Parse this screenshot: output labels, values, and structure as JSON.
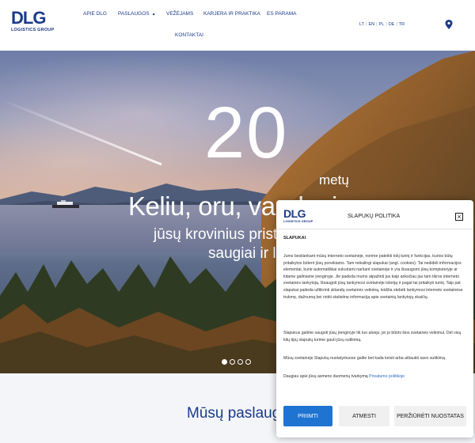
{
  "logo": {
    "mark": "DLG",
    "sub": "LOGISTICS GROUP"
  },
  "nav": {
    "items": [
      "APIE DLG",
      "PASLAUGOS",
      "VEŽĖJAMS",
      "KARJERA IR PRAKTIKA",
      "ES PARAMA",
      "KONTAKTAI"
    ],
    "dropdown_arrow": "▲"
  },
  "languages": [
    "LT",
    "EN",
    "PL",
    "DE",
    "TR"
  ],
  "hero": {
    "number": "20",
    "number_suffix": "metų",
    "headline": "Keliu, oru, vandeniu",
    "subline_1": "jūsų krovinius pristatome",
    "subline_2": "saugiai ir laiku"
  },
  "carousel": {
    "slides": 4,
    "active_index": 0
  },
  "services": {
    "title": "Mūsų paslaugos"
  },
  "cookie_modal": {
    "logo_mark": "DLG",
    "logo_sub": "LOGISTICS GROUP",
    "title": "SLAPUKŲ POLITIKA",
    "close_symbol": "×",
    "section": "SLAPUKAI",
    "paragraph_1": "Jums besilankant mūsų interneto svetainėje, norime pateikti tokį turinį ir funkcijas, kurios būtų pritaikytos būtent jūsų poreikiams. Tam reikalingi slapukai (angl. cookies). Tai nedideli informacijos elementai, kurie automatiškai sukuriami naršant svetainėje ir yra išsaugomi jūsų kompiuteryje ar kitame galiniame įrenginyje. Jie padeda mums atpažinti jus kaip anksčiau jau tam tikros interneto svetainės lankytoją. Išsaugoti jūsų lankymosi svetainėje istoriją ir pagal tai pritaikyti turinį. Taip pat slapukai padeda užtikrinti sklandų svetainės veikimą, leidžia stebėti lankymosi interneto svetainėse trukmę, dažnumą bei rinkti statistinę informaciją apie svetainių lankytojų skaičių.",
    "paragraph_2": "Slapukus galime saugoti jūsų įrenginyje tik tuo atveju, jei jo būtini šios svetainės veikimui. Dėl visų kitų tipų slapukų turime gauti jūsų sutikimą.",
    "paragraph_3": "Mūsų svetainėje Slapukų nustatymuose galite bet kada keisti arba atšaukti savo sutikimą.",
    "paragraph_4_prefix": "Daugiau apie jūsų asmens duomenų tvarkymą",
    "privacy_link": "Privatumo politikoje",
    "btn_accept": "PRIIMTI",
    "btn_reject": "ATMESTI",
    "btn_preferences": "PERŽIŪRĖTI NUOSTATAS"
  },
  "colors": {
    "brand": "#1b3a8a",
    "accept": "#1e74d0",
    "link": "#2a6bc6"
  }
}
